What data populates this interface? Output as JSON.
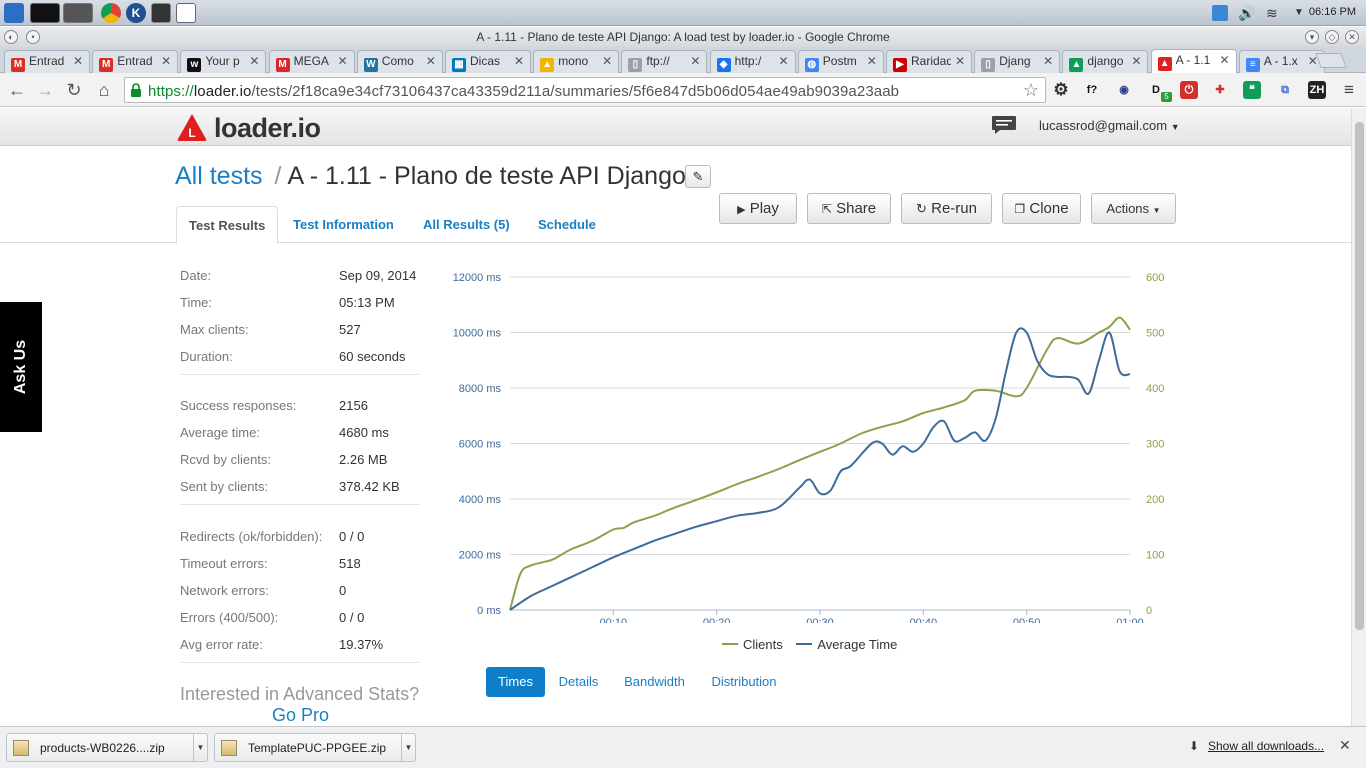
{
  "os": {
    "clock": "06:16 PM",
    "launchers": [
      "kde-menu-icon",
      "terminal-icon",
      "file-manager-icon",
      "chrome-icon",
      "k-app-icon",
      "console-icon",
      "calendar-icon"
    ],
    "tray": [
      "dropbox-icon",
      "volume-icon",
      "wifi-icon",
      "tray-arrow-icon"
    ]
  },
  "window": {
    "title": "A - 1.11 - Plano de teste API Django: A load test by loader.io - Google Chrome"
  },
  "tabs": [
    {
      "title": "Entrad",
      "icon": "gmail-icon",
      "color": "#d93025",
      "glyph": "M"
    },
    {
      "title": "Entrad",
      "icon": "gmail-icon",
      "color": "#d93025",
      "glyph": "M"
    },
    {
      "title": "Your p",
      "icon": "w-icon",
      "color": "#111111",
      "glyph": "w"
    },
    {
      "title": "MEGA",
      "icon": "mega-icon",
      "color": "#d9272e",
      "glyph": "M"
    },
    {
      "title": "Como",
      "icon": "wordpress-icon",
      "color": "#21759b",
      "glyph": "W"
    },
    {
      "title": "Dicas",
      "icon": "trello-icon",
      "color": "#0079bf",
      "glyph": "▦"
    },
    {
      "title": "mono",
      "icon": "drive-icon",
      "color": "#f4b400",
      "glyph": "▲"
    },
    {
      "title": "ftp://",
      "icon": "page-icon",
      "color": "#9aa0a6",
      "glyph": "▯"
    },
    {
      "title": "http:/",
      "icon": "code-icon",
      "color": "#1a73e8",
      "glyph": "◆"
    },
    {
      "title": "Postm",
      "icon": "globe-icon",
      "color": "#4285f4",
      "glyph": "◍"
    },
    {
      "title": "Raridad",
      "icon": "youtube-icon",
      "color": "#cc0000",
      "glyph": "▶"
    },
    {
      "title": "Djang",
      "icon": "page-icon",
      "color": "#9aa0a6",
      "glyph": "▯"
    },
    {
      "title": "django",
      "icon": "drive-icon",
      "color": "#0f9d58",
      "glyph": "▲"
    },
    {
      "title": "A - 1.1",
      "icon": "loader-icon",
      "color": "#e02020",
      "glyph": "▲",
      "active": true
    },
    {
      "title": "A - 1.x",
      "icon": "docs-icon",
      "color": "#4285f4",
      "glyph": "≡"
    }
  ],
  "address": {
    "scheme": "https://",
    "host": "loader.io",
    "path": "/tests/2f18ca9e34cf73106437ca43359d211a/summaries/5f6e847d5b06d054ae49ab9039a23aab"
  },
  "extensions": [
    {
      "name": "gear-icon",
      "glyph": "⚙",
      "color": "#333333",
      "bg": "transparent"
    },
    {
      "name": "formula-icon",
      "glyph": "f?",
      "color": "#111111",
      "bg": "transparent"
    },
    {
      "name": "magnifier-icon",
      "glyph": "◉",
      "color": "#2c3e8f",
      "bg": "transparent"
    },
    {
      "name": "d-extension-icon",
      "glyph": "D",
      "color": "#111111",
      "bg": "transparent"
    },
    {
      "name": "stop-icon",
      "glyph": "⏻",
      "color": "#ffffff",
      "bg": "#d32f2f"
    },
    {
      "name": "cross-icon",
      "glyph": "✚",
      "color": "#d32f2f",
      "bg": "transparent"
    },
    {
      "name": "hangouts-icon",
      "glyph": "❝",
      "color": "#ffffff",
      "bg": "#0f9d58"
    },
    {
      "name": "cast-icon",
      "glyph": "⧉",
      "color": "#3b73c8",
      "bg": "transparent"
    },
    {
      "name": "zh-icon",
      "glyph": "ZH",
      "color": "#ffffff",
      "bg": "#222222"
    },
    {
      "name": "menu-icon",
      "glyph": "≡",
      "color": "#444444",
      "bg": "transparent"
    }
  ],
  "extension_badge": "5",
  "header": {
    "logo": "loader.io",
    "user": "lucassrod@gmail.com"
  },
  "page": {
    "breadcrumb": "All tests",
    "separator": "/",
    "title": "A - 1.11 - Plano de teste API Django",
    "tabs": [
      "Test Results",
      "Test Information",
      "All Results (5)",
      "Schedule"
    ],
    "actions": [
      "Play",
      "Share",
      "Re-run",
      "Clone",
      "Actions"
    ]
  },
  "stats": {
    "general": [
      {
        "label": "Date:",
        "value": "Sep 09, 2014"
      },
      {
        "label": "Time:",
        "value": "05:13 PM"
      },
      {
        "label": "Max clients:",
        "value": "527"
      },
      {
        "label": "Duration:",
        "value": "60 seconds"
      }
    ],
    "responses": [
      {
        "label": "Success responses:",
        "value": "2156"
      },
      {
        "label": "Average time:",
        "value": "4680 ms"
      },
      {
        "label": "Rcvd by clients:",
        "value": "2.26 MB"
      },
      {
        "label": "Sent by clients:",
        "value": "378.42 KB"
      }
    ],
    "errors": [
      {
        "label": "Redirects (ok/forbidden):",
        "value": "0 / 0"
      },
      {
        "label": "Timeout errors:",
        "value": "518"
      },
      {
        "label": "Network errors:",
        "value": "0"
      },
      {
        "label": "Errors (400/500):",
        "value": "0 / 0"
      },
      {
        "label": "Avg error rate:",
        "value": "19.37%"
      }
    ],
    "advanced_prompt": "Interested in Advanced Stats?",
    "go_pro": "Go Pro"
  },
  "chart_data": {
    "type": "line",
    "title": "",
    "xlabel": "",
    "ylabel": "",
    "x_range_seconds": [
      0,
      60
    ],
    "x_ticks": [
      "00:10",
      "00:20",
      "00:30",
      "00:40",
      "00:50",
      "01:00"
    ],
    "y_left_ticks": [
      "0 ms",
      "2000 ms",
      "4000 ms",
      "6000 ms",
      "8000 ms",
      "10000 ms",
      "12000 ms"
    ],
    "y_left_range": [
      0,
      12000
    ],
    "y_right_ticks": [
      "0",
      "100",
      "200",
      "300",
      "400",
      "500",
      "600"
    ],
    "y_right_range": [
      0,
      600
    ],
    "grid": true,
    "legend": "bottom",
    "series": [
      {
        "name": "Clients",
        "axis": "right",
        "color": "#8ca04a",
        "x": [
          0,
          1,
          2,
          4,
          5,
          6,
          8,
          10,
          11,
          12,
          14,
          16,
          18,
          20,
          22,
          24,
          26,
          28,
          30,
          32,
          34,
          36,
          38,
          40,
          42,
          44,
          45,
          47,
          49,
          50,
          52,
          53,
          55,
          57,
          58,
          59,
          60
        ],
        "values": [
          0,
          65,
          80,
          90,
          100,
          110,
          125,
          145,
          148,
          158,
          170,
          185,
          198,
          212,
          227,
          240,
          254,
          270,
          285,
          300,
          318,
          330,
          340,
          355,
          365,
          378,
          395,
          395,
          385,
          400,
          470,
          490,
          480,
          500,
          510,
          527,
          505
        ]
      },
      {
        "name": "Average Time",
        "axis": "left",
        "color": "#3d6b9a",
        "x": [
          0,
          2,
          4,
          6,
          8,
          10,
          12,
          14,
          16,
          18,
          20,
          22,
          24,
          26,
          28,
          29,
          30,
          31,
          32,
          33,
          35,
          36,
          37,
          38,
          39,
          40,
          41,
          42,
          43,
          44,
          45,
          46,
          47,
          48,
          49,
          50,
          51,
          52,
          53,
          54,
          55,
          56,
          57,
          58,
          59,
          60
        ],
        "values": [
          0,
          500,
          850,
          1200,
          1550,
          1900,
          2200,
          2500,
          2750,
          3000,
          3200,
          3400,
          3500,
          3700,
          4400,
          4700,
          4200,
          4300,
          5000,
          5200,
          6000,
          6000,
          5600,
          5900,
          5700,
          6000,
          6600,
          6800,
          6100,
          6200,
          6400,
          6100,
          6900,
          8600,
          10000,
          10000,
          9000,
          8500,
          8400,
          8400,
          8300,
          7800,
          9000,
          10000,
          8600,
          8500
        ]
      }
    ]
  },
  "view_tabs": [
    "Times",
    "Details",
    "Bandwidth",
    "Distribution"
  ],
  "ask_us": "Ask Us",
  "downloads": {
    "items": [
      "products-WB0226....zip",
      "TemplatePUC-PPGEE.zip"
    ],
    "show_all": "Show all downloads..."
  }
}
